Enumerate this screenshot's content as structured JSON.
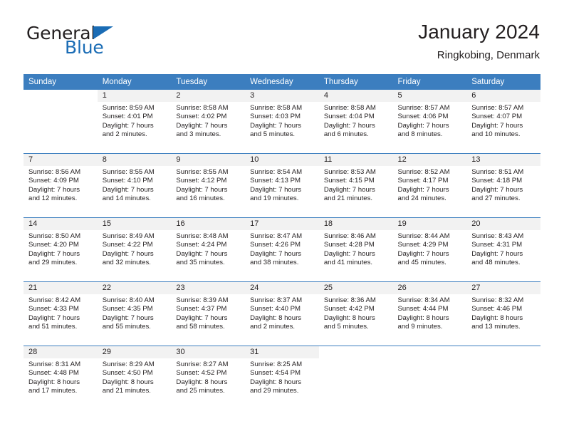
{
  "brand": {
    "word_general": "General",
    "word_blue": "Blue",
    "accent_color": "#1a6cb5"
  },
  "header": {
    "title": "January 2024",
    "subtitle": "Ringkobing, Denmark"
  },
  "calendar": {
    "header_background": "#3c7ebf",
    "daynum_background": "#f2f2f2",
    "weekday_headers": [
      "Sunday",
      "Monday",
      "Tuesday",
      "Wednesday",
      "Thursday",
      "Friday",
      "Saturday"
    ],
    "weeks": [
      [
        {
          "day": "",
          "sunrise": "",
          "sunset": "",
          "daylight": "",
          "blank": true
        },
        {
          "day": "1",
          "sunrise": "Sunrise: 8:59 AM",
          "sunset": "Sunset: 4:01 PM",
          "daylight": "Daylight: 7 hours and 2 minutes."
        },
        {
          "day": "2",
          "sunrise": "Sunrise: 8:58 AM",
          "sunset": "Sunset: 4:02 PM",
          "daylight": "Daylight: 7 hours and 3 minutes."
        },
        {
          "day": "3",
          "sunrise": "Sunrise: 8:58 AM",
          "sunset": "Sunset: 4:03 PM",
          "daylight": "Daylight: 7 hours and 5 minutes."
        },
        {
          "day": "4",
          "sunrise": "Sunrise: 8:58 AM",
          "sunset": "Sunset: 4:04 PM",
          "daylight": "Daylight: 7 hours and 6 minutes."
        },
        {
          "day": "5",
          "sunrise": "Sunrise: 8:57 AM",
          "sunset": "Sunset: 4:06 PM",
          "daylight": "Daylight: 7 hours and 8 minutes."
        },
        {
          "day": "6",
          "sunrise": "Sunrise: 8:57 AM",
          "sunset": "Sunset: 4:07 PM",
          "daylight": "Daylight: 7 hours and 10 minutes."
        }
      ],
      [
        {
          "day": "7",
          "sunrise": "Sunrise: 8:56 AM",
          "sunset": "Sunset: 4:09 PM",
          "daylight": "Daylight: 7 hours and 12 minutes."
        },
        {
          "day": "8",
          "sunrise": "Sunrise: 8:55 AM",
          "sunset": "Sunset: 4:10 PM",
          "daylight": "Daylight: 7 hours and 14 minutes."
        },
        {
          "day": "9",
          "sunrise": "Sunrise: 8:55 AM",
          "sunset": "Sunset: 4:12 PM",
          "daylight": "Daylight: 7 hours and 16 minutes."
        },
        {
          "day": "10",
          "sunrise": "Sunrise: 8:54 AM",
          "sunset": "Sunset: 4:13 PM",
          "daylight": "Daylight: 7 hours and 19 minutes."
        },
        {
          "day": "11",
          "sunrise": "Sunrise: 8:53 AM",
          "sunset": "Sunset: 4:15 PM",
          "daylight": "Daylight: 7 hours and 21 minutes."
        },
        {
          "day": "12",
          "sunrise": "Sunrise: 8:52 AM",
          "sunset": "Sunset: 4:17 PM",
          "daylight": "Daylight: 7 hours and 24 minutes."
        },
        {
          "day": "13",
          "sunrise": "Sunrise: 8:51 AM",
          "sunset": "Sunset: 4:18 PM",
          "daylight": "Daylight: 7 hours and 27 minutes."
        }
      ],
      [
        {
          "day": "14",
          "sunrise": "Sunrise: 8:50 AM",
          "sunset": "Sunset: 4:20 PM",
          "daylight": "Daylight: 7 hours and 29 minutes."
        },
        {
          "day": "15",
          "sunrise": "Sunrise: 8:49 AM",
          "sunset": "Sunset: 4:22 PM",
          "daylight": "Daylight: 7 hours and 32 minutes."
        },
        {
          "day": "16",
          "sunrise": "Sunrise: 8:48 AM",
          "sunset": "Sunset: 4:24 PM",
          "daylight": "Daylight: 7 hours and 35 minutes."
        },
        {
          "day": "17",
          "sunrise": "Sunrise: 8:47 AM",
          "sunset": "Sunset: 4:26 PM",
          "daylight": "Daylight: 7 hours and 38 minutes."
        },
        {
          "day": "18",
          "sunrise": "Sunrise: 8:46 AM",
          "sunset": "Sunset: 4:28 PM",
          "daylight": "Daylight: 7 hours and 41 minutes."
        },
        {
          "day": "19",
          "sunrise": "Sunrise: 8:44 AM",
          "sunset": "Sunset: 4:29 PM",
          "daylight": "Daylight: 7 hours and 45 minutes."
        },
        {
          "day": "20",
          "sunrise": "Sunrise: 8:43 AM",
          "sunset": "Sunset: 4:31 PM",
          "daylight": "Daylight: 7 hours and 48 minutes."
        }
      ],
      [
        {
          "day": "21",
          "sunrise": "Sunrise: 8:42 AM",
          "sunset": "Sunset: 4:33 PM",
          "daylight": "Daylight: 7 hours and 51 minutes."
        },
        {
          "day": "22",
          "sunrise": "Sunrise: 8:40 AM",
          "sunset": "Sunset: 4:35 PM",
          "daylight": "Daylight: 7 hours and 55 minutes."
        },
        {
          "day": "23",
          "sunrise": "Sunrise: 8:39 AM",
          "sunset": "Sunset: 4:37 PM",
          "daylight": "Daylight: 7 hours and 58 minutes."
        },
        {
          "day": "24",
          "sunrise": "Sunrise: 8:37 AM",
          "sunset": "Sunset: 4:40 PM",
          "daylight": "Daylight: 8 hours and 2 minutes."
        },
        {
          "day": "25",
          "sunrise": "Sunrise: 8:36 AM",
          "sunset": "Sunset: 4:42 PM",
          "daylight": "Daylight: 8 hours and 5 minutes."
        },
        {
          "day": "26",
          "sunrise": "Sunrise: 8:34 AM",
          "sunset": "Sunset: 4:44 PM",
          "daylight": "Daylight: 8 hours and 9 minutes."
        },
        {
          "day": "27",
          "sunrise": "Sunrise: 8:32 AM",
          "sunset": "Sunset: 4:46 PM",
          "daylight": "Daylight: 8 hours and 13 minutes."
        }
      ],
      [
        {
          "day": "28",
          "sunrise": "Sunrise: 8:31 AM",
          "sunset": "Sunset: 4:48 PM",
          "daylight": "Daylight: 8 hours and 17 minutes."
        },
        {
          "day": "29",
          "sunrise": "Sunrise: 8:29 AM",
          "sunset": "Sunset: 4:50 PM",
          "daylight": "Daylight: 8 hours and 21 minutes."
        },
        {
          "day": "30",
          "sunrise": "Sunrise: 8:27 AM",
          "sunset": "Sunset: 4:52 PM",
          "daylight": "Daylight: 8 hours and 25 minutes."
        },
        {
          "day": "31",
          "sunrise": "Sunrise: 8:25 AM",
          "sunset": "Sunset: 4:54 PM",
          "daylight": "Daylight: 8 hours and 29 minutes."
        },
        {
          "day": "",
          "sunrise": "",
          "sunset": "",
          "daylight": "",
          "blank": true
        },
        {
          "day": "",
          "sunrise": "",
          "sunset": "",
          "daylight": "",
          "blank": true
        },
        {
          "day": "",
          "sunrise": "",
          "sunset": "",
          "daylight": "",
          "blank": true
        }
      ]
    ]
  }
}
